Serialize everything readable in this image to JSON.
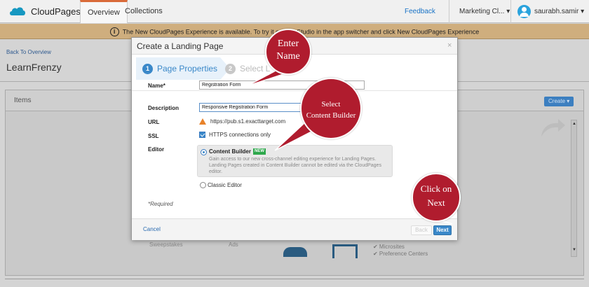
{
  "topbar": {
    "app_name": "CloudPages",
    "tabs": [
      {
        "label": "Overview"
      },
      {
        "label": "Collections"
      }
    ],
    "feedback": "Feedback",
    "business_unit": "Marketing Cl...",
    "user": "saurabh.samir"
  },
  "banner": {
    "text": "The New CloudPages Experience is available. To try it out, ho                           Studio in the app switcher and click New CloudPages Experience"
  },
  "page": {
    "back_link": "Back To Overview",
    "title": "LearnFrenzy",
    "items_title": "Items",
    "create_label": "Create ▾",
    "bg_labels": [
      "Sweepstakes",
      "Ads",
      "✔ Microsites",
      "✔ Preference Centers"
    ]
  },
  "modal": {
    "title": "Create a Landing Page",
    "close": "×",
    "steps": [
      {
        "num": "1",
        "label": "Page Properties"
      },
      {
        "num": "2",
        "label": "Select L"
      }
    ],
    "fields": {
      "name_label": "Name*",
      "name_value": "Registration Form",
      "description_label": "Description",
      "description_value": "Responsive Registration Form",
      "url_label": "URL",
      "url_value": "https://pub.s1.exacttarget.com",
      "ssl_label": "SSL",
      "ssl_option": "HTTPS connections only",
      "editor_label": "Editor",
      "content_builder": "Content Builder",
      "new_badge": "NEW",
      "content_builder_desc": "Gain access to our new cross-channel editing experience for Landing Pages. Landing Pages created in Content Builder cannot be edited via the CloudPages editor.",
      "classic_editor": "Classic Editor",
      "required_note": "*Required"
    },
    "footer": {
      "cancel": "Cancel",
      "back": "Back",
      "next": "Next"
    }
  },
  "callouts": [
    {
      "line1": "Enter",
      "line2": "Name"
    },
    {
      "line1": "Select",
      "line2": "Content Builder"
    },
    {
      "line1": "Click on",
      "line2": "Next"
    }
  ],
  "colors": {
    "accent": "#3a88c9",
    "callout": "#b01c2e",
    "brand_orange": "#d96b3a"
  }
}
